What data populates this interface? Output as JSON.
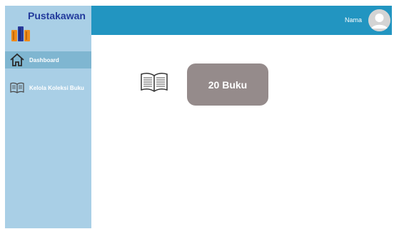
{
  "app": {
    "title": "Pustakawan"
  },
  "sidebar": {
    "items": [
      {
        "label": "Dashboard",
        "icon": "home-icon",
        "active": true
      },
      {
        "label": "Kelola Koleksi Buku",
        "icon": "book-icon",
        "active": false
      }
    ]
  },
  "header": {
    "user_name": "Nama"
  },
  "main": {
    "book_count_label": "20 Buku"
  },
  "colors": {
    "sidebar": "#a9cfe6",
    "sidebar_active": "#7fb6d1",
    "topbar": "#2295c1",
    "card": "#958b8b",
    "brand_text": "#223a9c"
  }
}
